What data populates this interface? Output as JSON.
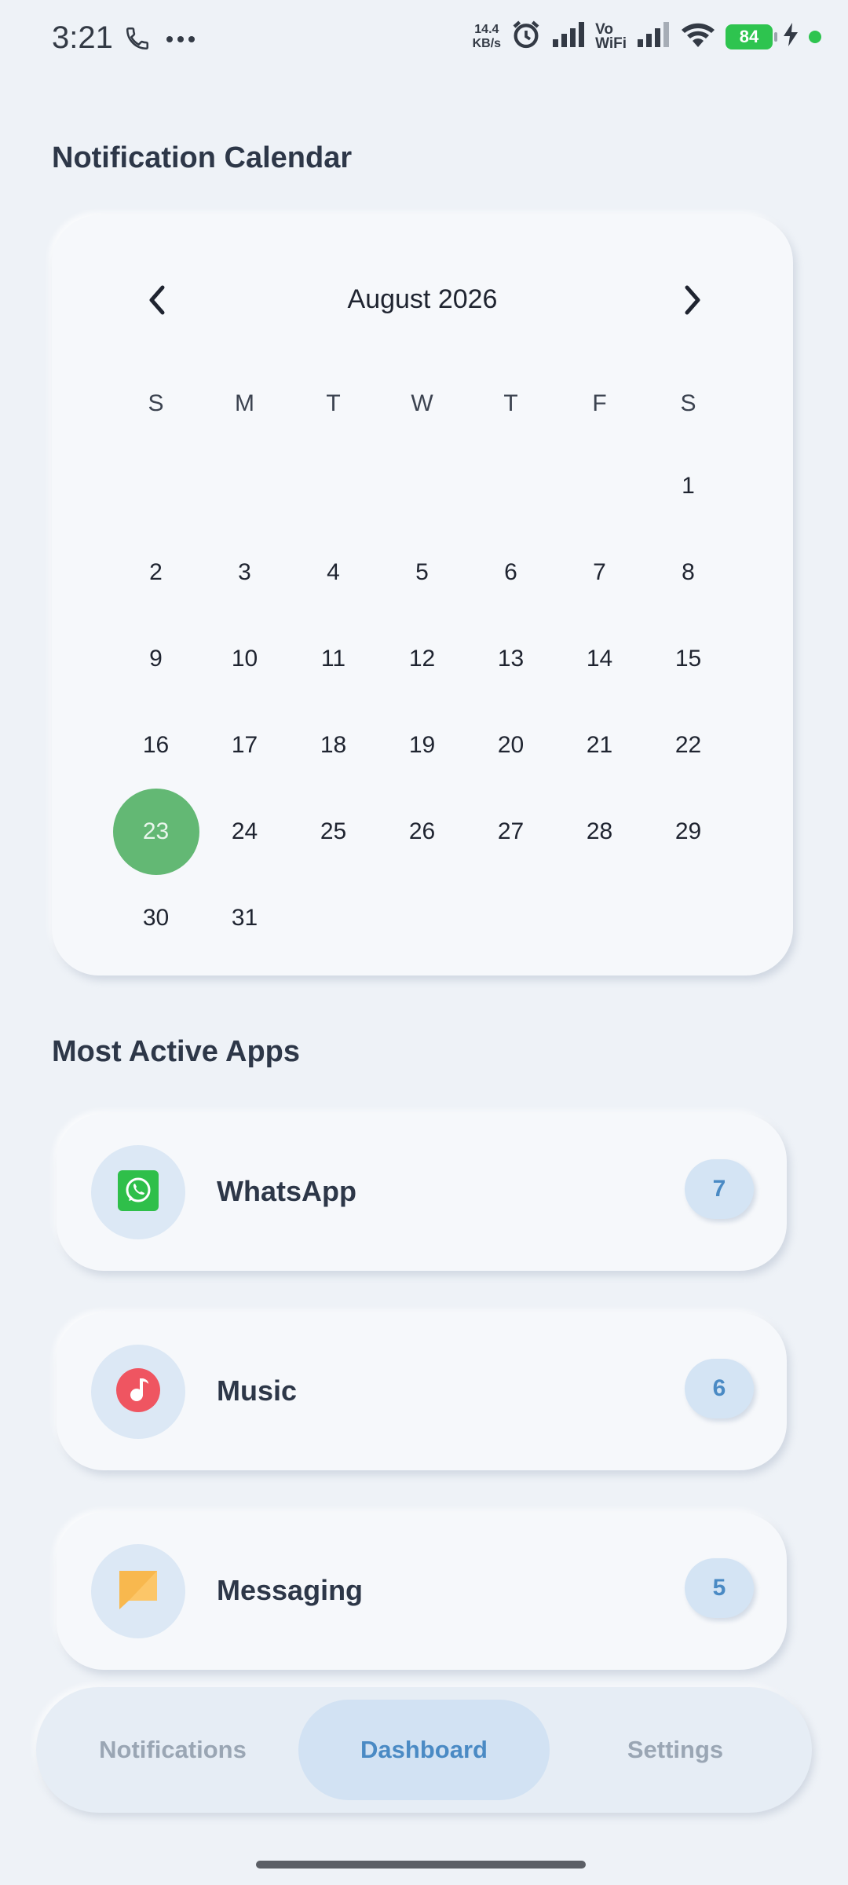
{
  "status_bar": {
    "time": "3:21",
    "net_speed_value": "14.4",
    "net_speed_unit": "KB/s",
    "vowifi_top": "Vo",
    "vowifi_bottom": "WiFi",
    "battery": "84"
  },
  "calendar": {
    "title": "Notification Calendar",
    "month_label": "August 2026",
    "weekdays": [
      "S",
      "M",
      "T",
      "W",
      "T",
      "F",
      "S"
    ],
    "weeks": [
      [
        "",
        "",
        "",
        "",
        "",
        "",
        "1"
      ],
      [
        "2",
        "3",
        "4",
        "5",
        "6",
        "7",
        "8"
      ],
      [
        "9",
        "10",
        "11",
        "12",
        "13",
        "14",
        "15"
      ],
      [
        "16",
        "17",
        "18",
        "19",
        "20",
        "21",
        "22"
      ],
      [
        "23",
        "24",
        "25",
        "26",
        "27",
        "28",
        "29"
      ],
      [
        "30",
        "31",
        "",
        "",
        "",
        "",
        ""
      ]
    ],
    "selected_day": "23",
    "selected_color": "#63b874"
  },
  "most_active": {
    "title": "Most Active Apps",
    "apps": [
      {
        "name": "WhatsApp",
        "count": "7",
        "icon": "whatsapp-icon"
      },
      {
        "name": "Music",
        "count": "6",
        "icon": "music-icon"
      },
      {
        "name": "Messaging",
        "count": "5",
        "icon": "messaging-icon"
      }
    ]
  },
  "bottom_nav": {
    "items": [
      {
        "label": "Notifications",
        "active": false
      },
      {
        "label": "Dashboard",
        "active": true
      },
      {
        "label": "Settings",
        "active": false
      }
    ],
    "accent_color": "#4a8ac4"
  }
}
